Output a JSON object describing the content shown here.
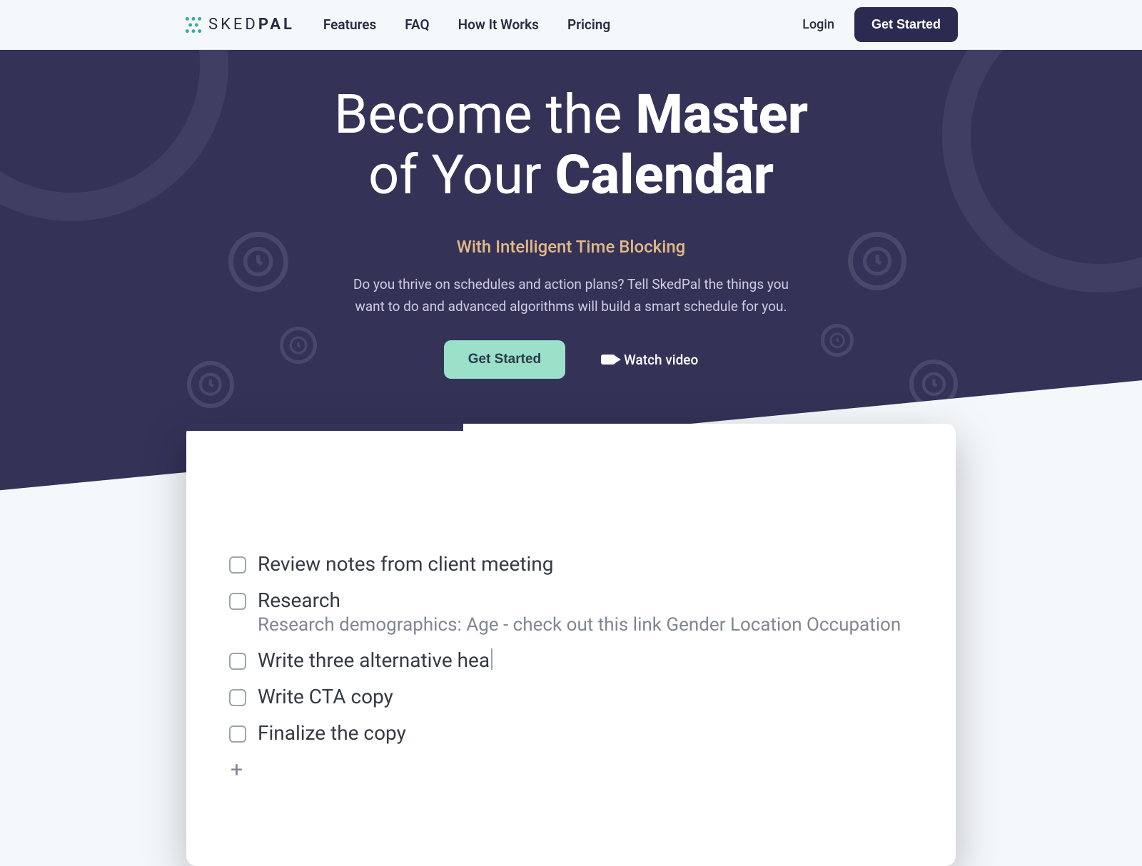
{
  "brand": {
    "sked": "SKED",
    "pal": "PAL"
  },
  "nav": {
    "features": "Features",
    "faq": "FAQ",
    "how": "How It Works",
    "pricing": "Pricing"
  },
  "auth": {
    "login": "Login",
    "get_started": "Get Started"
  },
  "hero": {
    "title_1": "Become the ",
    "title_1b": "Master",
    "title_2": "of Your ",
    "title_2b": "Calendar",
    "subtitle": "With Intelligent Time Blocking",
    "description": "Do you thrive on schedules and action plans? Tell SkedPal the things you want to do and advanced algorithms will build a smart schedule for you.",
    "cta_primary": "Get Started",
    "cta_video": "Watch video"
  },
  "tasks": {
    "items": [
      {
        "label": "Review notes from client meeting",
        "sub": null
      },
      {
        "label": "Research",
        "sub": "Research demographics: Age - check out this link Gender Location Occupation"
      },
      {
        "label": "Write three alternative hea",
        "sub": null,
        "typing": true
      },
      {
        "label": "Write CTA copy",
        "sub": null
      },
      {
        "label": "Finalize the copy",
        "sub": null
      }
    ],
    "add_glyph": "+"
  }
}
